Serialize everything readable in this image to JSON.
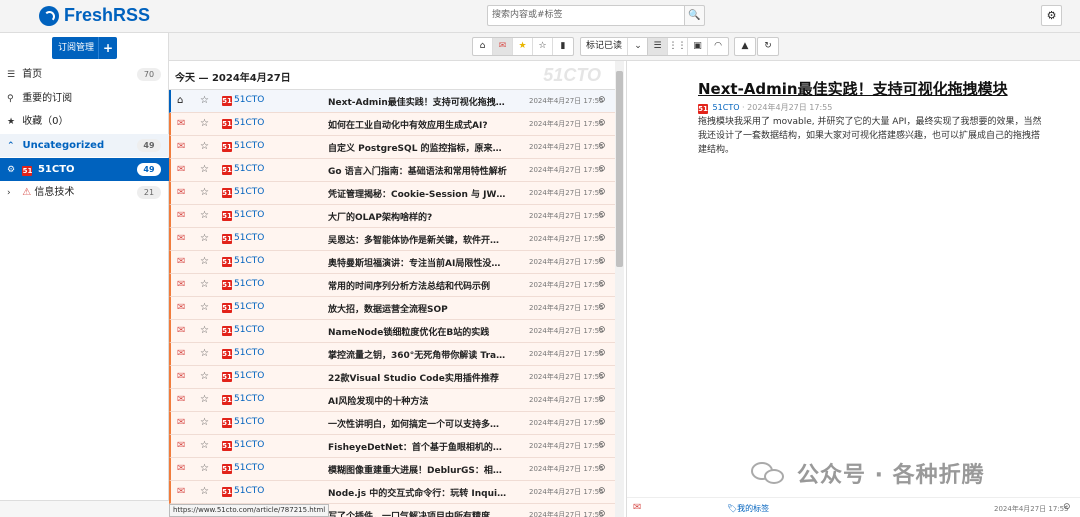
{
  "app": {
    "title": "FreshRSS",
    "search_placeholder": "搜索内容或#标签"
  },
  "colors": {
    "accent": "#0062be",
    "unread": "#f07c3c",
    "star": "#e9b600",
    "mail": "#d9534f"
  },
  "sidebar": {
    "subscribe_label": "订阅管理",
    "items": [
      {
        "label": "首页",
        "count": "70",
        "icon": "list-icon"
      },
      {
        "label": "重要的订阅",
        "count": "",
        "icon": "pin-icon"
      },
      {
        "label": "收藏（0）",
        "count": "",
        "icon": "star-icon"
      },
      {
        "label": "Uncategorized",
        "count": "49",
        "icon": "chevron-down-icon"
      },
      {
        "label": "51CTO",
        "count": "49",
        "icon": "gear-icon"
      },
      {
        "label": "信息技术",
        "count": "21",
        "icon": "warning-icon"
      }
    ]
  },
  "toolbar": {
    "mark_read_label": "标记已读"
  },
  "list": {
    "day_label": "今天 — 2024年4月27日",
    "watermark": "51CTO",
    "feed_name": "51CTO",
    "status_url": "https://www.51cto.com/article/787215.html",
    "items": [
      {
        "title": "Next-Admin最佳实践！支持可视化拖拽模块",
        "date": "2024年4月27日 17:55"
      },
      {
        "title": "如何在工业自动化中有效应用生成式AI?",
        "date": "2024年4月27日 17:55"
      },
      {
        "title": "自定义 PostgreSQL 的监控指标，原来可以这么...",
        "date": "2024年4月27日 17:55"
      },
      {
        "title": "Go 语言入门指南：基础语法和常用特性解析",
        "date": "2024年4月27日 17:55"
      },
      {
        "title": "凭证管理揭秘：Cookie-Session 与 JWT 方案的...",
        "date": "2024年4月27日 17:55"
      },
      {
        "title": "大厂的OLAP架构啥样的?",
        "date": "2024年4月27日 17:55"
      },
      {
        "title": "吴恩达：多智能体协作是新关键，软件开发等任...",
        "date": "2024年4月27日 17:55"
      },
      {
        "title": "奥特曼斯坦福演讲：专注当前AI局限性没用，G...",
        "date": "2024年4月27日 17:55"
      },
      {
        "title": "常用的时间序列分析方法总结和代码示例",
        "date": "2024年4月27日 17:55"
      },
      {
        "title": "放大招，数据运营全流程SOP",
        "date": "2024年4月27日 17:55"
      },
      {
        "title": "NameNode锁细粒度优化在B站的实践",
        "date": "2024年4月27日 17:55"
      },
      {
        "title": "掌控流量之钥，360°无死角带你解读 Traefik Pr...",
        "date": "2024年4月27日 17:55"
      },
      {
        "title": "22款Visual Studio Code实用插件推荐",
        "date": "2024年4月27日 17:55"
      },
      {
        "title": "AI风险发现中的十种方法",
        "date": "2024年4月27日 17:55"
      },
      {
        "title": "一次性讲明白，如何搞定一个可以支持多芯混合...",
        "date": "2024年4月27日 17:55"
      },
      {
        "title": "FisheyeDetNet：首个基于鱼眼相机的目标检测...",
        "date": "2024年4月27日 17:55"
      },
      {
        "title": "模糊图像重建重大进展！DeblurGS：相机位姿...",
        "date": "2024年4月27日 17:55"
      },
      {
        "title": "Node.js 中的交互式命令行：玩转 Inquirer.js",
        "date": "2024年4月27日 17:55"
      },
      {
        "title": "写了个插件，一口气解决项目中所有精度丢失问题",
        "date": "2024年4月27日 17:55"
      }
    ]
  },
  "article": {
    "title": "Next-Admin最佳实践！支持可视化拖拽模块",
    "feed": "51CTO",
    "meta_date": "· 2024年4月27日 17:55",
    "body": "拖拽模块我采用了 movable, 并研究了它的大量 API，最终实现了我想要的效果，当然我还设计了一套数据结构，如果大家对可视化搭建感兴趣，也可以扩展成自己的拖拽搭建结构。",
    "watermark_text": "公众号 · 各种折腾",
    "footer_tags": "我的标签",
    "footer_date": "2024年4月27日 17:55"
  }
}
